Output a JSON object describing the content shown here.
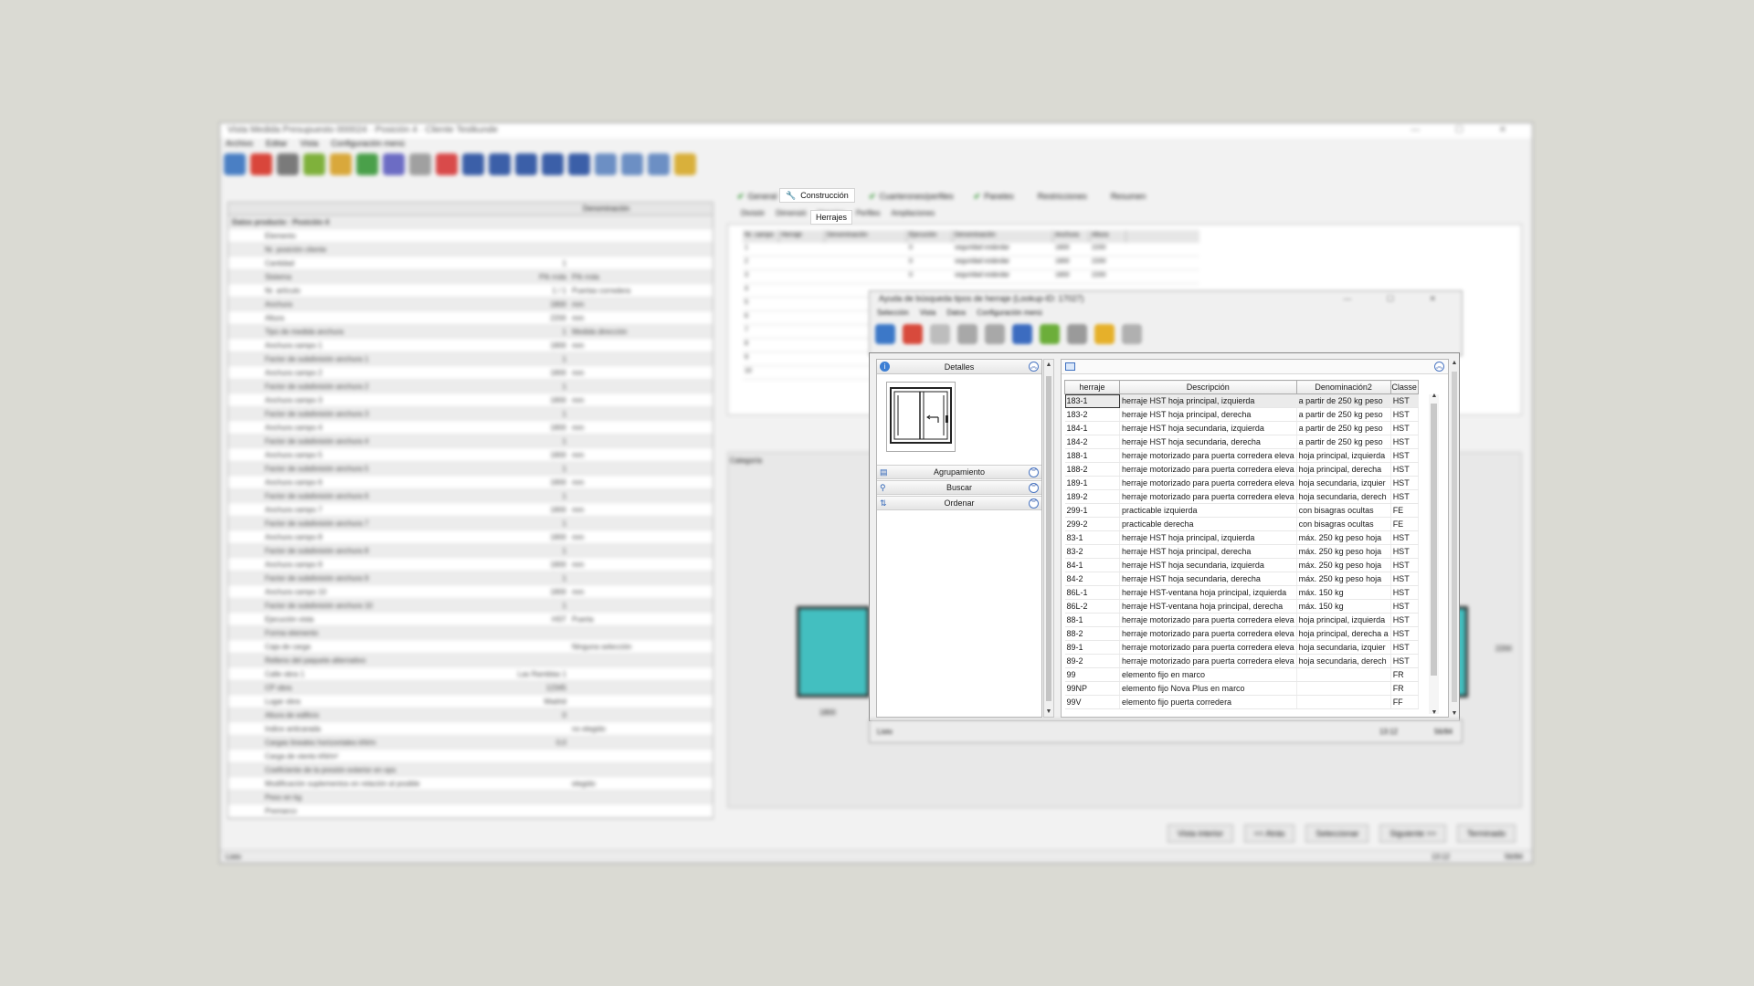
{
  "background_app": {
    "title": "Vista Medida Presupuesto 000024 · Posición 4 · Cliente Testkunde",
    "window_controls": "— ☐ ✕",
    "menu": [
      "Archivo",
      "Editar",
      "Vista",
      "Configuración menú"
    ],
    "toolbar_colors": [
      "#4a7fc4",
      "#d9463b",
      "#7a7a7a",
      "#7fb13b",
      "#d9a83b",
      "#4aa04a",
      "#6c6cc4",
      "#a0a0a0",
      "#d94a4a",
      "#3b5fa8",
      "#3b5fa8",
      "#3b5fa8",
      "#3b5fa8",
      "#3b5fa8",
      "#6c8fc4",
      "#6c8fc4",
      "#6c8fc4",
      "#d9b03b"
    ],
    "grid_header": "Denominación",
    "grid_section": "Datos producto · Posición 4",
    "grid_rows": [
      {
        "label": "Elemento",
        "value": "",
        "unit": ""
      },
      {
        "label": "Nr. posición cliente",
        "value": "",
        "unit": ""
      },
      {
        "label": "Cantidad",
        "value": "1",
        "unit": ""
      },
      {
        "label": "Sistema",
        "value": "P/k rrola",
        "unit": "P/k rrola"
      },
      {
        "label": "Nr. artículo",
        "value": "1 / 1",
        "unit": "Puertas corredera"
      },
      {
        "label": "Anchura",
        "value": "1800",
        "unit": "mm"
      },
      {
        "label": "Altura",
        "value": "2200",
        "unit": "mm"
      },
      {
        "label": "Tipo de medida anchura",
        "value": "1",
        "unit": "Medida dirección"
      },
      {
        "label": "Anchura campo 1",
        "value": "1800",
        "unit": "mm"
      },
      {
        "label": "Factor de subdivisión anchura 1",
        "value": "1",
        "unit": ""
      },
      {
        "label": "Anchura campo 2",
        "value": "1800",
        "unit": "mm"
      },
      {
        "label": "Factor de subdivisión anchura 2",
        "value": "1",
        "unit": ""
      },
      {
        "label": "Anchura campo 3",
        "value": "1800",
        "unit": "mm"
      },
      {
        "label": "Factor de subdivisión anchura 3",
        "value": "1",
        "unit": ""
      },
      {
        "label": "Anchura campo 4",
        "value": "1800",
        "unit": "mm"
      },
      {
        "label": "Factor de subdivisión anchura 4",
        "value": "1",
        "unit": ""
      },
      {
        "label": "Anchura campo 5",
        "value": "1800",
        "unit": "mm"
      },
      {
        "label": "Factor de subdivisión anchura 5",
        "value": "1",
        "unit": ""
      },
      {
        "label": "Anchura campo 6",
        "value": "1800",
        "unit": "mm"
      },
      {
        "label": "Factor de subdivisión anchura 6",
        "value": "1",
        "unit": ""
      },
      {
        "label": "Anchura campo 7",
        "value": "1800",
        "unit": "mm"
      },
      {
        "label": "Factor de subdivisión anchura 7",
        "value": "1",
        "unit": ""
      },
      {
        "label": "Anchura campo 8",
        "value": "1800",
        "unit": "mm"
      },
      {
        "label": "Factor de subdivisión anchura 8",
        "value": "1",
        "unit": ""
      },
      {
        "label": "Anchura campo 9",
        "value": "1800",
        "unit": "mm"
      },
      {
        "label": "Factor de subdivisión anchura 9",
        "value": "1",
        "unit": ""
      },
      {
        "label": "Anchura campo 10",
        "value": "1800",
        "unit": "mm"
      },
      {
        "label": "Factor de subdivisión anchura 10",
        "value": "1",
        "unit": ""
      },
      {
        "label": "Ejecución vista",
        "value": "HST",
        "unit": "Puerta"
      },
      {
        "label": "Forma elemento",
        "value": "",
        "unit": ""
      },
      {
        "label": "Caja de carga",
        "value": "",
        "unit": "Ninguna selección"
      },
      {
        "label": "Relleno del paquete alternativo",
        "value": "",
        "unit": ""
      },
      {
        "label": "Calle obra 1",
        "value": "Las Ramblas 1",
        "unit": ""
      },
      {
        "label": "CP obra",
        "value": "12345",
        "unit": ""
      },
      {
        "label": "Lugar obra",
        "value": "Madrid",
        "unit": ""
      },
      {
        "label": "Altura de edificio",
        "value": "0",
        "unit": ""
      },
      {
        "label": "Indice anticarada",
        "value": "",
        "unit": "no elegido"
      },
      {
        "label": "Cargas lineales horizontales kN/m",
        "value": "0,0",
        "unit": ""
      },
      {
        "label": "Carga de viento kN/m²",
        "value": "",
        "unit": ""
      },
      {
        "label": "Coeficiente de la presión exterior en ops",
        "value": "",
        "unit": ""
      },
      {
        "label": "Modificación suplementos en relación al posible",
        "value": "",
        "unit": "elegido"
      },
      {
        "label": "Peso en kg",
        "value": "",
        "unit": ""
      },
      {
        "label": "Premarco",
        "value": "",
        "unit": ""
      }
    ],
    "tabs": [
      {
        "label": "General",
        "check": "✔"
      },
      {
        "label": "Construcción",
        "check": ""
      },
      {
        "label": "Cuarterones/perfiles",
        "check": "✔"
      },
      {
        "label": "Paneles",
        "check": "✔"
      },
      {
        "label": "Restricciones",
        "check": ""
      },
      {
        "label": "Resumen",
        "check": ""
      }
    ],
    "active_tab_label": "Construcción",
    "active_tab_icon": "wrench-icon",
    "subtabs": [
      "Divisiór",
      "Dimensió",
      "Herrajes",
      "Perfiles",
      "Ampliaciones"
    ],
    "active_subtab_label": "Herrajes",
    "right_grid_headers": [
      "Nr. campo",
      "Herraje",
      "Denominación",
      "Ejecución",
      "Denominación",
      "Anchura",
      "Altura"
    ],
    "right_grid_rows": [
      [
        "1",
        "",
        "",
        "0",
        "seguridad estándar",
        "1800",
        "2200"
      ],
      [
        "2",
        "",
        "",
        "0",
        "seguridad estándar",
        "1800",
        "2200"
      ],
      [
        "3",
        "",
        "",
        "0",
        "seguridad estándar",
        "1800",
        "2200"
      ],
      [
        "4",
        "",
        "",
        "",
        "",
        "",
        ""
      ],
      [
        "5",
        "",
        "",
        "",
        "",
        "",
        ""
      ],
      [
        "6",
        "",
        "",
        "",
        "",
        "",
        ""
      ],
      [
        "7",
        "",
        "",
        "",
        "",
        "",
        ""
      ],
      [
        "8",
        "",
        "",
        "",
        "",
        "",
        ""
      ],
      [
        "9",
        "",
        "",
        "",
        "",
        "",
        ""
      ],
      [
        "10",
        "",
        "",
        "",
        "",
        "",
        ""
      ]
    ],
    "category_label": "Categoría",
    "dim_left": "1800",
    "dim_right": "2200",
    "bottom_buttons": [
      "Vista interior",
      "<< Atrás",
      "Seleccionar",
      "Siguiente >>",
      "Terminado"
    ],
    "status_left": "Listo",
    "status_right": "13:12",
    "status_extra": "56/84"
  },
  "dialog": {
    "title": "Ayuda de búsqueda tipos de herraje (Lookup-ID: 17027)",
    "window_controls": "— ☐ ✕",
    "menu": [
      "Selección",
      "Vista",
      "Datos",
      "Configuración menú"
    ],
    "tool_colors": [
      "#3c78c8",
      "#d84a3c",
      "#bdbdbd",
      "#a8a8a8",
      "#a8a8a8",
      "#3c6cc0",
      "#6cae3a",
      "#9a9a9a",
      "#e6b02a",
      "#b0b0b0"
    ],
    "status_left": "Listo",
    "status_mid": "13:12",
    "status_right": "56/84",
    "left_pane": {
      "header": "Detalles",
      "sections": [
        {
          "label": "Agrupamiento",
          "icon": "grouping-icon",
          "glyph": "▤"
        },
        {
          "label": "Buscar",
          "icon": "search-icon",
          "glyph": "⚲"
        },
        {
          "label": "Ordenar",
          "icon": "sort-icon",
          "glyph": "⇅"
        }
      ]
    },
    "grid": {
      "columns": [
        "herraje",
        "Descripción",
        "Denominación2",
        "Classe"
      ],
      "rows": [
        [
          "183-1",
          "herraje HST hoja principal, izquierda",
          "a partir de 250 kg peso",
          "HST"
        ],
        [
          "183-2",
          "herraje HST hoja principal, derecha",
          "a partir de 250 kg peso",
          "HST"
        ],
        [
          "184-1",
          "herraje HST hoja secundaria, izquierda",
          "a partir de 250 kg peso",
          "HST"
        ],
        [
          "184-2",
          "herraje HST hoja secundaria, derecha",
          "a partir de 250 kg peso",
          "HST"
        ],
        [
          "188-1",
          "herraje motorizado para puerta corredera eleva",
          "hoja principal, izquierda",
          "HST"
        ],
        [
          "188-2",
          "herraje motorizado para puerta corredera eleva",
          "hoja principal, derecha",
          "HST"
        ],
        [
          "189-1",
          "herraje motorizado para puerta corredera eleva",
          "hoja secundaria, izquier",
          "HST"
        ],
        [
          "189-2",
          "herraje motorizado para puerta corredera eleva",
          "hoja secundaria, derech",
          "HST"
        ],
        [
          "299-1",
          "practicable izquierda",
          "con bisagras ocultas",
          "FE"
        ],
        [
          "299-2",
          "practicable derecha",
          "con bisagras ocultas",
          "FE"
        ],
        [
          "83-1",
          "herraje HST hoja principal, izquierda",
          "máx. 250 kg peso hoja",
          "HST"
        ],
        [
          "83-2",
          "herraje HST hoja principal, derecha",
          "máx. 250 kg peso hoja",
          "HST"
        ],
        [
          "84-1",
          "herraje HST hoja secundaria, izquierda",
          "máx. 250 kg peso hoja",
          "HST"
        ],
        [
          "84-2",
          "herraje HST hoja secundaria, derecha",
          "máx. 250 kg peso hoja",
          "HST"
        ],
        [
          "86L-1",
          "herraje HST-ventana hoja principal, izquierda",
          "máx. 150 kg",
          "HST"
        ],
        [
          "86L-2",
          "herraje HST-ventana hoja principal, derecha",
          "máx. 150 kg",
          "HST"
        ],
        [
          "88-1",
          "herraje motorizado para puerta corredera eleva",
          "hoja principal, izquierda",
          "HST"
        ],
        [
          "88-2",
          "herraje motorizado para puerta corredera eleva",
          "hoja principal, derecha a",
          "HST"
        ],
        [
          "89-1",
          "herraje motorizado para puerta corredera eleva",
          "hoja secundaria, izquier",
          "HST"
        ],
        [
          "89-2",
          "herraje motorizado para puerta corredera eleva",
          "hoja secundaria, derech",
          "HST"
        ],
        [
          "99",
          "elemento fijo en marco",
          "",
          "FR"
        ],
        [
          "99NP",
          "elemento fijo Nova Plus en marco",
          "",
          "FR"
        ],
        [
          "99V",
          "elemento fijo puerta corredera",
          "",
          "FF"
        ]
      ]
    }
  }
}
